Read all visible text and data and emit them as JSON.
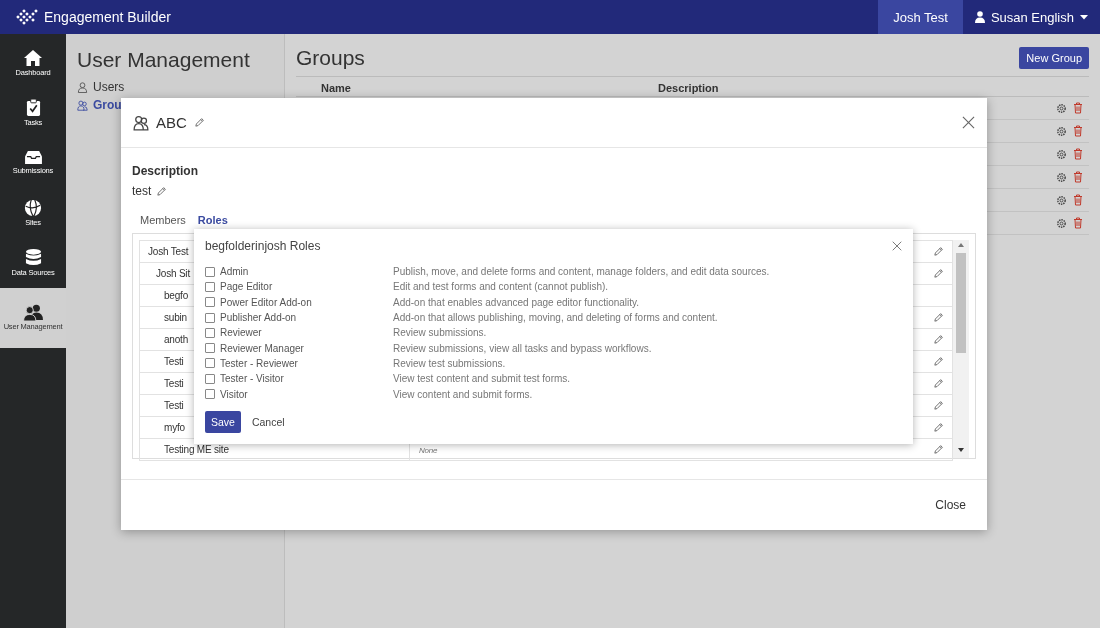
{
  "topbar": {
    "app_name": "Engagement Builder",
    "account": "Josh Test",
    "user": "Susan English"
  },
  "sidebar": {
    "items": [
      {
        "label": "Dashboard",
        "kind": "home",
        "selected": false
      },
      {
        "label": "Tasks",
        "kind": "tasks",
        "selected": false
      },
      {
        "label": "Submissions",
        "kind": "inbox",
        "selected": false
      },
      {
        "label": "Sites",
        "kind": "globe",
        "selected": false
      },
      {
        "label": "Data Sources",
        "kind": "database",
        "selected": false
      },
      {
        "label": "User Management",
        "kind": "users",
        "selected": true
      }
    ]
  },
  "user_management": {
    "title": "User Management",
    "nav": [
      {
        "label": "Users",
        "kind": "user",
        "selected": false
      },
      {
        "label": "Grou",
        "kind": "group",
        "selected": true
      }
    ]
  },
  "groups": {
    "title": "Groups",
    "new_button": "New Group",
    "columns": [
      "Name",
      "Description"
    ]
  },
  "modal": {
    "title": "ABC",
    "description_label": "Description",
    "description": "test",
    "tabs": [
      {
        "label": "Members",
        "selected": false
      },
      {
        "label": "Roles",
        "selected": true
      }
    ],
    "tree": [
      {
        "name": "Josh Test",
        "editable": true,
        "children": [
          {
            "name": "Josh Sit",
            "editable": true,
            "children": [
              {
                "name": "begfo",
                "editable": false
              },
              {
                "name": "subin",
                "editable": true
              },
              {
                "name": "anoth",
                "editable": true
              },
              {
                "name": "Testi",
                "editable": true
              },
              {
                "name": "Testi",
                "editable": true
              },
              {
                "name": "Testi",
                "editable": true
              },
              {
                "name": "myfo",
                "editable": true
              },
              {
                "name": "Testing ME site",
                "value": "None",
                "editable": true
              }
            ]
          }
        ]
      }
    ],
    "close_button": "Close"
  },
  "roles_popup": {
    "title": "begfolderinjosh Roles",
    "roles": [
      {
        "name": "Admin",
        "description": "Publish, move, and delete forms and content, manage folders, and edit data sources.",
        "checked": false
      },
      {
        "name": "Page Editor",
        "description": "Edit and test forms and content (cannot publish).",
        "checked": false
      },
      {
        "name": "Power Editor Add-on",
        "description": "Add-on that enables advanced page editor functionality.",
        "checked": false
      },
      {
        "name": "Publisher Add-on",
        "description": "Add-on that allows publishing, moving, and deleting of forms and content.",
        "checked": false
      },
      {
        "name": "Reviewer",
        "description": "Review submissions.",
        "checked": false
      },
      {
        "name": "Reviewer Manager",
        "description": "Review submissions, view all tasks and bypass workflows.",
        "checked": false
      },
      {
        "name": "Tester - Reviewer",
        "description": "Review test submissions.",
        "checked": false
      },
      {
        "name": "Tester - Visitor",
        "description": "View test content and submit test forms.",
        "checked": false
      },
      {
        "name": "Visitor",
        "description": "View content and submit forms.",
        "checked": false
      }
    ],
    "save_button": "Save",
    "cancel_button": "Cancel"
  }
}
